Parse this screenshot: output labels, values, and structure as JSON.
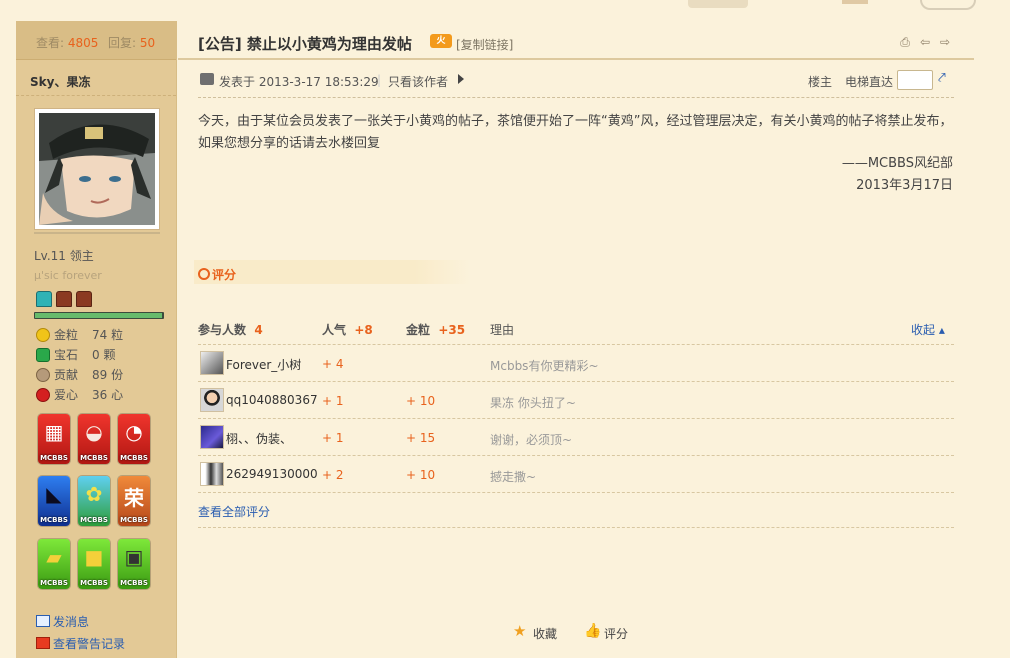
{
  "stats": {
    "views_label": "查看:",
    "views_value": "4805",
    "replies_label": "回复:",
    "replies_value": "50"
  },
  "thread": {
    "title": "[公告] 禁止以小黄鸡为理由发帖",
    "hot_badge": "火",
    "copy_link": "[复制链接]",
    "posted_at": "发表于 2013-3-17 18:53:29",
    "only_author": "只看该作者",
    "floor_owner": "楼主",
    "elevator": "电梯直达"
  },
  "post": {
    "body": "今天，由于某位会员发表了一张关于小黄鸡的帖子，茶馆便开始了一阵“黄鸡”风，经过管理层决定，有关小黄鸡的帖子将禁止发布，如果您想分享的话请去水楼回复",
    "sign_org": "——MCBBS风纪部",
    "sign_date": "2013年3月17日"
  },
  "user": {
    "name": "Sky、果冻",
    "level": "Lv.11 领主",
    "signature": "μ'sic forever",
    "progress": 0.99,
    "attrs": [
      {
        "label": "金粒",
        "value": "74 粒",
        "icon": "gold-nugget-icon",
        "color": "#f0c419"
      },
      {
        "label": "宝石",
        "value": "0 颗",
        "icon": "emerald-icon",
        "color": "#2aa84a"
      },
      {
        "label": "贡献",
        "value": "89 份",
        "icon": "contribution-icon",
        "color": "#b59a7a"
      },
      {
        "label": "爱心",
        "value": "36 心",
        "icon": "heart-apple-icon",
        "color": "#d42020"
      }
    ],
    "medal_tag": "MCBBS",
    "send_message": "发消息",
    "view_warnings": "查看警告记录"
  },
  "rating": {
    "label": "评分",
    "header": {
      "participants": "参与人数",
      "participants_count": "4",
      "popularity": "人气",
      "popularity_total": "+8",
      "gold": "金粒",
      "gold_total": "+35",
      "reason": "理由",
      "collapse": "收起"
    },
    "rows": [
      {
        "name": "Forever_小树",
        "pop": "+ 4",
        "gold": "",
        "reason": "Mcbbs有你更精彩~"
      },
      {
        "name": "qq1040880367",
        "pop": "+ 1",
        "gold": "+ 10",
        "reason": "果冻 你头扭了~"
      },
      {
        "name": "栩、、伪装、",
        "pop": "+ 1",
        "gold": "+ 15",
        "reason": "谢谢，必须顶~"
      },
      {
        "name": "262949130000",
        "pop": "+ 2",
        "gold": "+ 10",
        "reason": "撼走撒~"
      }
    ],
    "see_all": "查看全部评分"
  },
  "actions": {
    "favorite": "收藏",
    "rate": "评分"
  },
  "colors": {
    "accent": "#e8621d",
    "link": "#2a5db0",
    "sidebar": "#e3c996",
    "bg": "#fbf2db"
  }
}
